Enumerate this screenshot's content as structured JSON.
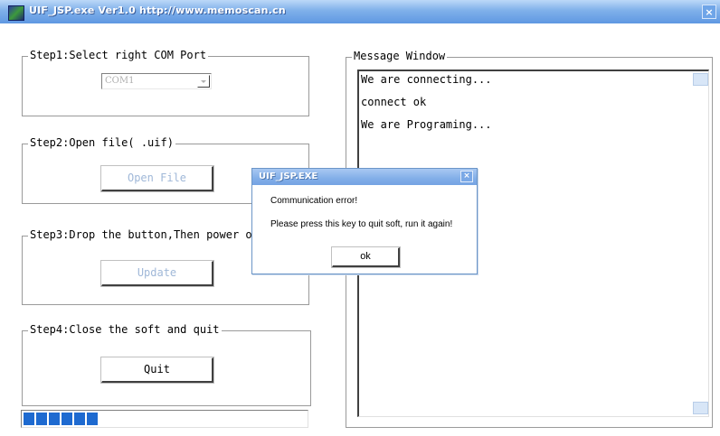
{
  "window": {
    "title": "UIF_JSP.exe  Ver1.0  http://www.memoscan.cn",
    "close_glyph": "×",
    "icon": "app-icon"
  },
  "step1": {
    "legend": "Step1:Select right COM Port",
    "com_value": "COM1"
  },
  "step2": {
    "legend": "Step2:Open file( .uif)",
    "button": "Open File"
  },
  "step3": {
    "legend": "Step3:Drop the button,Then power on",
    "button": "Update"
  },
  "step4": {
    "legend": "Step4:Close the soft and quit",
    "button": "Quit"
  },
  "progress": {
    "fraction": 0.27,
    "accent": "#1e6ad0"
  },
  "messages": {
    "legend": "Message Window",
    "lines": [
      "We are connecting...",
      "connect ok",
      "We are Programing..."
    ]
  },
  "dialog": {
    "title": "UIF_JSP.EXE",
    "message1": "Communication error!",
    "message2": "Please press this key to quit soft, run it again!",
    "ok": "ok",
    "close_glyph": "×"
  },
  "colors": {
    "titlebar": "#5f98e2",
    "disabled_text": "#a0b8d8"
  }
}
